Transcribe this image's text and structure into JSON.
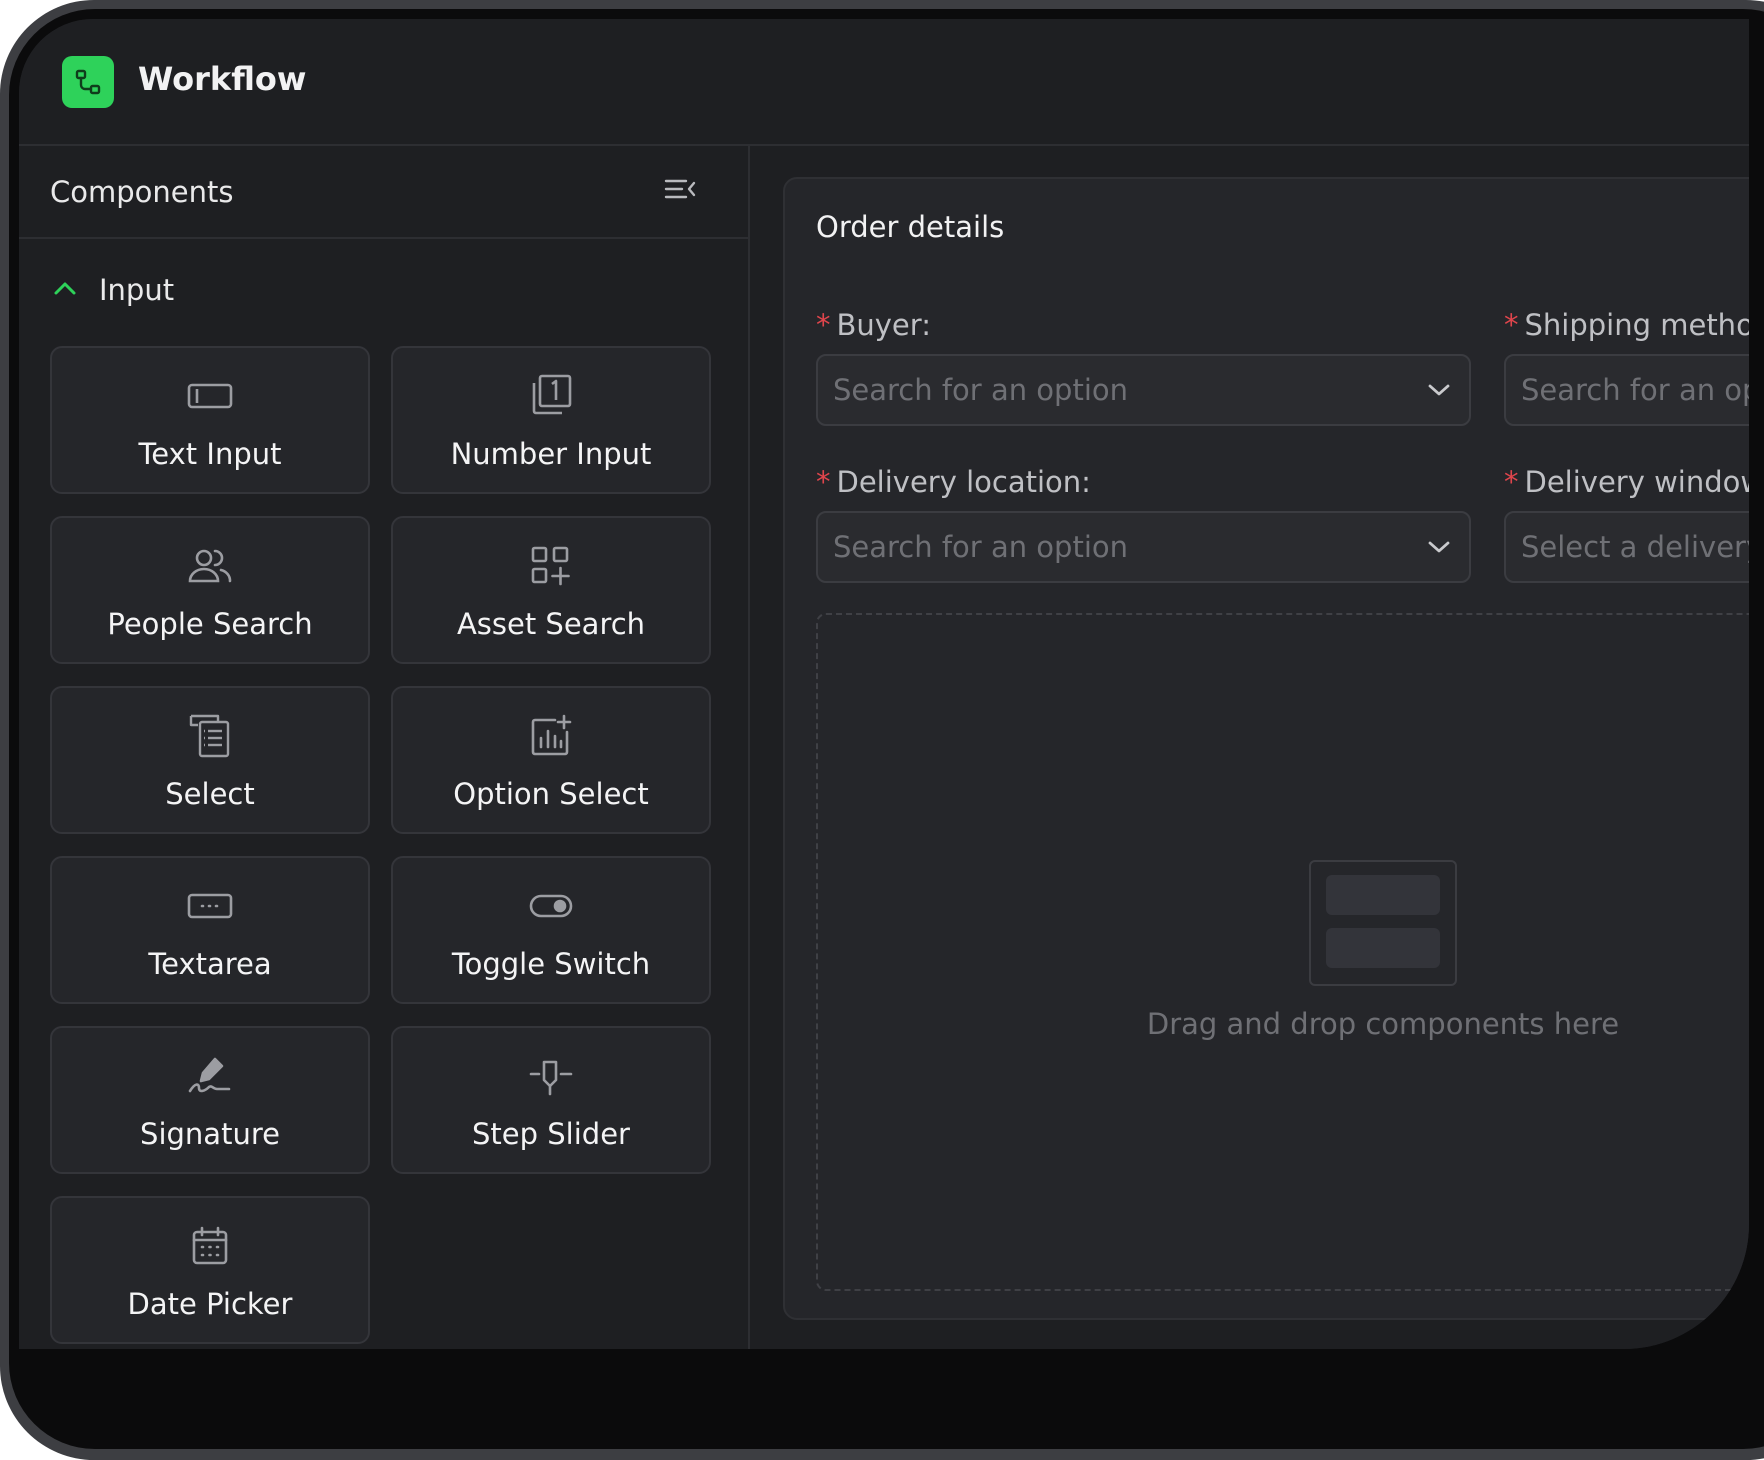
{
  "app": {
    "title": "Workflow",
    "logo_icon": "workflow-icon",
    "accent_color": "#2ed25a"
  },
  "sidebar": {
    "title": "Components",
    "collapse_icon": "collapse-menu-icon",
    "section": {
      "label": "Input",
      "icon": "chevron-up-icon",
      "expanded": true
    },
    "components": [
      {
        "label": "Text Input",
        "icon": "text-input-icon"
      },
      {
        "label": "Number Input",
        "icon": "number-input-icon"
      },
      {
        "label": "People Search",
        "icon": "people-icon"
      },
      {
        "label": "Asset Search",
        "icon": "asset-grid-icon"
      },
      {
        "label": "Select",
        "icon": "select-list-icon"
      },
      {
        "label": "Option Select",
        "icon": "option-chart-icon"
      },
      {
        "label": "Textarea",
        "icon": "textarea-icon"
      },
      {
        "label": "Toggle Switch",
        "icon": "toggle-icon"
      },
      {
        "label": "Signature",
        "icon": "signature-pen-icon"
      },
      {
        "label": "Step Slider",
        "icon": "slider-icon"
      },
      {
        "label": "Date Picker",
        "icon": "calendar-icon"
      }
    ]
  },
  "form": {
    "title": "Order details",
    "required_marker": "*",
    "fields": [
      {
        "label": "Buyer:",
        "placeholder": "Search for an option",
        "has_chevron": true
      },
      {
        "label": "Shipping method:",
        "placeholder": "Search for an option",
        "has_chevron": false
      },
      {
        "label": "Delivery location:",
        "placeholder": "Search for an option",
        "has_chevron": true
      },
      {
        "label": "Delivery window:",
        "placeholder": "Select a delivery window",
        "has_chevron": false
      }
    ],
    "dropzone": {
      "text": "Drag and drop components here"
    },
    "required_color": "#e0454c"
  }
}
